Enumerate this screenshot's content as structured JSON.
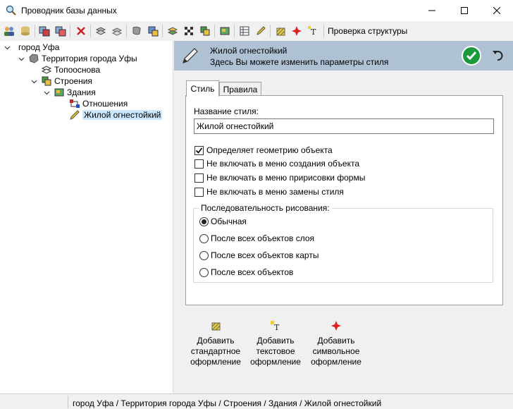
{
  "window": {
    "title": "Проводник базы данных",
    "icon": "magnifier-db-icon"
  },
  "toolbar": {
    "structure_check_label": "Проверка структуры",
    "buttons": [
      "users-icon",
      "db-add-icon",
      "copy-icon",
      "paste-icon",
      "delete-icon",
      "layers-icon",
      "layers-refresh-icon",
      "shape-icon",
      "import-icon",
      "style-stack-icon",
      "checker-icon",
      "layers-green-icon",
      "map-icon",
      "table-icon",
      "pencil-icon",
      "hatch-icon",
      "symbol-add-icon",
      "text-style-icon"
    ]
  },
  "tree": {
    "nodes": [
      {
        "label": "город Уфа",
        "icon": "none",
        "expand": "▾"
      },
      {
        "label": "Территория города Уфы",
        "icon": "territory-icon",
        "expand": "▾"
      },
      {
        "label": "Топооснова",
        "icon": "layers-icon",
        "expand": ""
      },
      {
        "label": "Строения",
        "icon": "buildings-icon",
        "expand": "▾"
      },
      {
        "label": "Здания",
        "icon": "building-icon",
        "expand": "▾"
      },
      {
        "label": "Отношения",
        "icon": "relations-icon",
        "expand": ""
      },
      {
        "label": "Жилой огнестойкий",
        "icon": "pencil-icon",
        "expand": "",
        "selected": true
      }
    ]
  },
  "header": {
    "title": "Жилой огнестойкий",
    "subtitle": "Здесь Вы можете изменить параметры стиля",
    "ok_icon": "checkmark-icon",
    "undo_icon": "undo-icon"
  },
  "tabs": [
    {
      "label": "Стиль",
      "active": true
    },
    {
      "label": "Правила",
      "active": false
    }
  ],
  "form": {
    "style_name_label": "Название стиля:",
    "style_name_value": "Жилой огнестойкий",
    "checkboxes": [
      {
        "label": "Определяет геометрию объекта",
        "checked": true
      },
      {
        "label": "Не включать в меню создания объекта",
        "checked": false
      },
      {
        "label": "Не включать в меню пририсовки формы",
        "checked": false
      },
      {
        "label": "Не включать в меню замены стиля",
        "checked": false
      }
    ],
    "draw_order": {
      "legend": "Последовательность рисования:",
      "options": [
        {
          "label": "Обычная",
          "selected": true
        },
        {
          "label": "После всех объектов слоя",
          "selected": false
        },
        {
          "label": "После всех объектов карты",
          "selected": false
        },
        {
          "label": "После всех объектов",
          "selected": false
        }
      ]
    }
  },
  "actions": [
    {
      "label": "Добавить стандартное оформление",
      "icon": "hatch-add-icon"
    },
    {
      "label": "Добавить текстовое оформление",
      "icon": "text-add-icon"
    },
    {
      "label": "Добавить символьное оформление",
      "icon": "symbol-add-icon"
    }
  ],
  "status": {
    "path": "город Уфа / Территория города Уфы / Строения / Здания / Жилой огнестойкий"
  },
  "colors": {
    "header_bg": "#aec2d4",
    "selection": "#cce8ff",
    "ok_green": "#1a9a3c"
  }
}
